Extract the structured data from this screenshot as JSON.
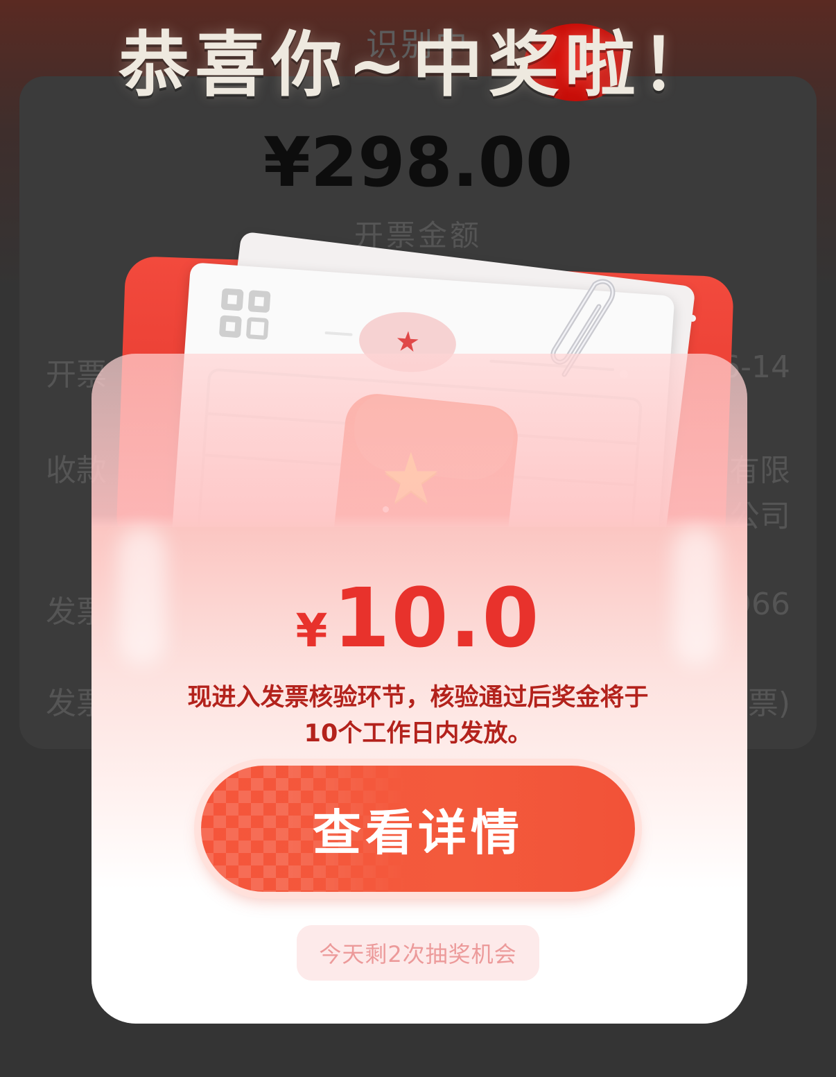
{
  "background": {
    "header_subtitle": "识别中",
    "amount": "¥298.00",
    "amount_label": "开票金额",
    "rows": [
      {
        "label": "开票",
        "value": "6-14"
      },
      {
        "label": "收款",
        "value": "有限"
      },
      {
        "label": "",
        "value": "公司"
      },
      {
        "label": "发票",
        "value": "966"
      },
      {
        "label": "发票",
        "value": "票)"
      }
    ]
  },
  "popup": {
    "title": "恭喜你~中奖啦！",
    "prize_currency": "¥",
    "prize_amount": "10.0",
    "description": "现进入发票核验环节，核验通过后奖金将于10个工作日内发放。",
    "detail_button_label": "查看详情",
    "remaining_chances": "今天剩2次抽奖机会"
  },
  "colors": {
    "accent_red": "#e8322c",
    "button_red": "#f5553b",
    "overlay": "#343434"
  },
  "icons": [
    "qr-code-icon",
    "star-stamp-icon",
    "paperclip-icon",
    "star-icon"
  ]
}
